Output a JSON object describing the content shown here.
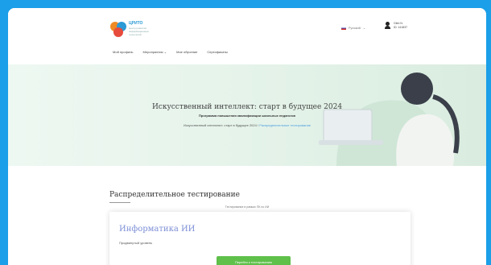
{
  "brand": {
    "name": "ЦРИТО",
    "subtitle": "Центр развития информационных технологий"
  },
  "lang": {
    "label": "Русский",
    "chevron": "chevron-down-icon"
  },
  "user": {
    "name": "Gleb N.",
    "id": "ID: 141837"
  },
  "nav": {
    "items": [
      "Мой профиль",
      "Мероприятия",
      "Мое обучение",
      "Сертификаты"
    ]
  },
  "hero": {
    "title": "Искусственный интеллект: старт в будущее 2024",
    "subtitle": "Программа повышения квалификации школьных педагогов",
    "breadcrumb": [
      "Искусственный интеллект: старт в будущее 2024",
      "Распределительное тестирование"
    ]
  },
  "section": {
    "title": "Распределительное тестирование",
    "note": "Тестирование в рамках ПК по ИИ"
  },
  "card": {
    "title": "Информатика ИИ",
    "level": "Продвинутый уровень",
    "button": "Перейти к тестированию"
  },
  "colors": {
    "frame": "#1a9fe8",
    "accent": "#5fc04a",
    "link": "#4a9de0"
  }
}
